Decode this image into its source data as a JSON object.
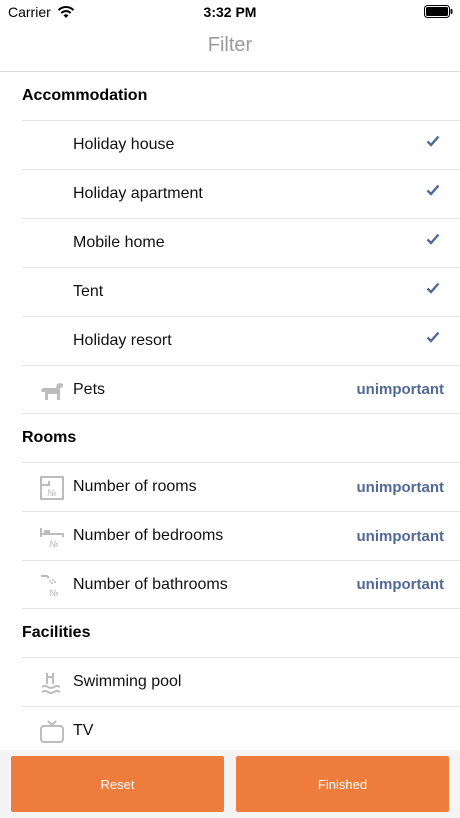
{
  "status": {
    "carrier": "Carrier",
    "time": "3:32 PM"
  },
  "nav": {
    "title": "Filter"
  },
  "sections": {
    "accommodation": {
      "title": "Accommodation",
      "items": [
        {
          "label": "Holiday house",
          "checked": true
        },
        {
          "label": "Holiday apartment",
          "checked": true
        },
        {
          "label": "Mobile home",
          "checked": true
        },
        {
          "label": "Tent",
          "checked": true
        },
        {
          "label": "Holiday resort",
          "checked": true
        }
      ],
      "pets": {
        "label": "Pets",
        "value": "unimportant",
        "icon": "dog-icon"
      }
    },
    "rooms": {
      "title": "Rooms",
      "items": [
        {
          "label": "Number of rooms",
          "value": "unimportant",
          "icon": "rooms-icon"
        },
        {
          "label": "Number of bedrooms",
          "value": "unimportant",
          "icon": "bed-icon"
        },
        {
          "label": "Number of bathrooms",
          "value": "unimportant",
          "icon": "shower-icon"
        }
      ]
    },
    "facilities": {
      "title": "Facilities",
      "items": [
        {
          "label": "Swimming pool",
          "icon": "swimming-pool-icon"
        },
        {
          "label": "TV",
          "icon": "tv-icon"
        }
      ]
    }
  },
  "footer": {
    "reset": "Reset",
    "finished": "Finished"
  },
  "colors": {
    "accent": "#ee7d3d",
    "value": "#516a94",
    "check": "#516a94",
    "icon": "#bdbdbd"
  }
}
